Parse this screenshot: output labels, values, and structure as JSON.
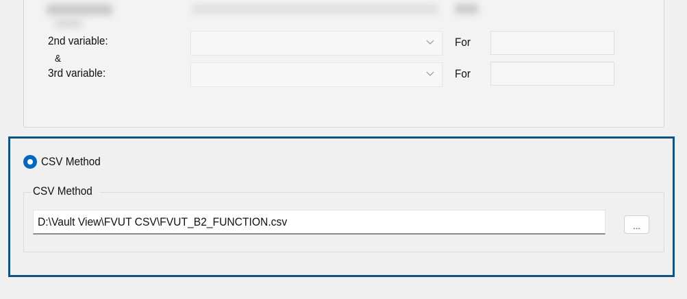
{
  "upper_section": {
    "rows": [
      {
        "label": "2nd variable:",
        "for_label": "For",
        "combo_value": "",
        "for_value": ""
      },
      {
        "label": "3rd variable:",
        "for_label": "For",
        "combo_value": "",
        "for_value": ""
      }
    ],
    "connector": "&"
  },
  "csv_section": {
    "radio_label": "CSV Method",
    "radio_selected": true,
    "group_title": "CSV Method",
    "file_path": "D:\\Vault View\\FVUT CSV\\FVUT_B2_FUNCTION.csv",
    "browse_label": "...",
    "accent_color": "#0f5384",
    "radio_color": "#0067c0"
  },
  "icons": {
    "dropdown": "chevron-down-icon",
    "radio": "radio-selected-icon"
  }
}
